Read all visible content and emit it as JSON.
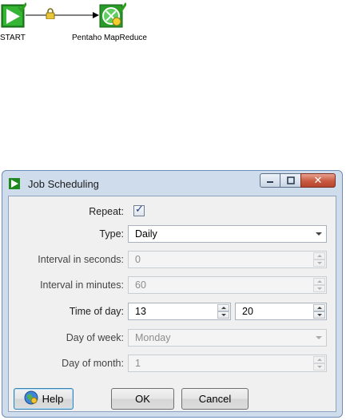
{
  "canvas": {
    "nodes": [
      {
        "label": "START",
        "icon": "start-job-icon"
      },
      {
        "label": "Pentaho MapReduce",
        "icon": "mapreduce-icon"
      }
    ],
    "hop": {
      "icon": "lock-icon"
    }
  },
  "dialog": {
    "title": "Job Scheduling",
    "fields": {
      "repeat": {
        "label": "Repeat:",
        "checked": true
      },
      "type": {
        "label": "Type:",
        "value": "Daily"
      },
      "interval_seconds": {
        "label": "Interval in seconds:",
        "value": "0"
      },
      "interval_minutes": {
        "label": "Interval in minutes:",
        "value": "60"
      },
      "time_of_day": {
        "label": "Time of day:",
        "hour": "13",
        "minute": "20"
      },
      "day_of_week": {
        "label": "Day of week:",
        "value": "Monday"
      },
      "day_of_month": {
        "label": "Day of month:",
        "value": "1"
      }
    },
    "buttons": {
      "help": "Help",
      "ok": "OK",
      "cancel": "Cancel"
    }
  },
  "colors": {
    "accent_green": "#2f9e20",
    "dialog_frame": "#cfdcec",
    "close_red": "#c85a40"
  }
}
